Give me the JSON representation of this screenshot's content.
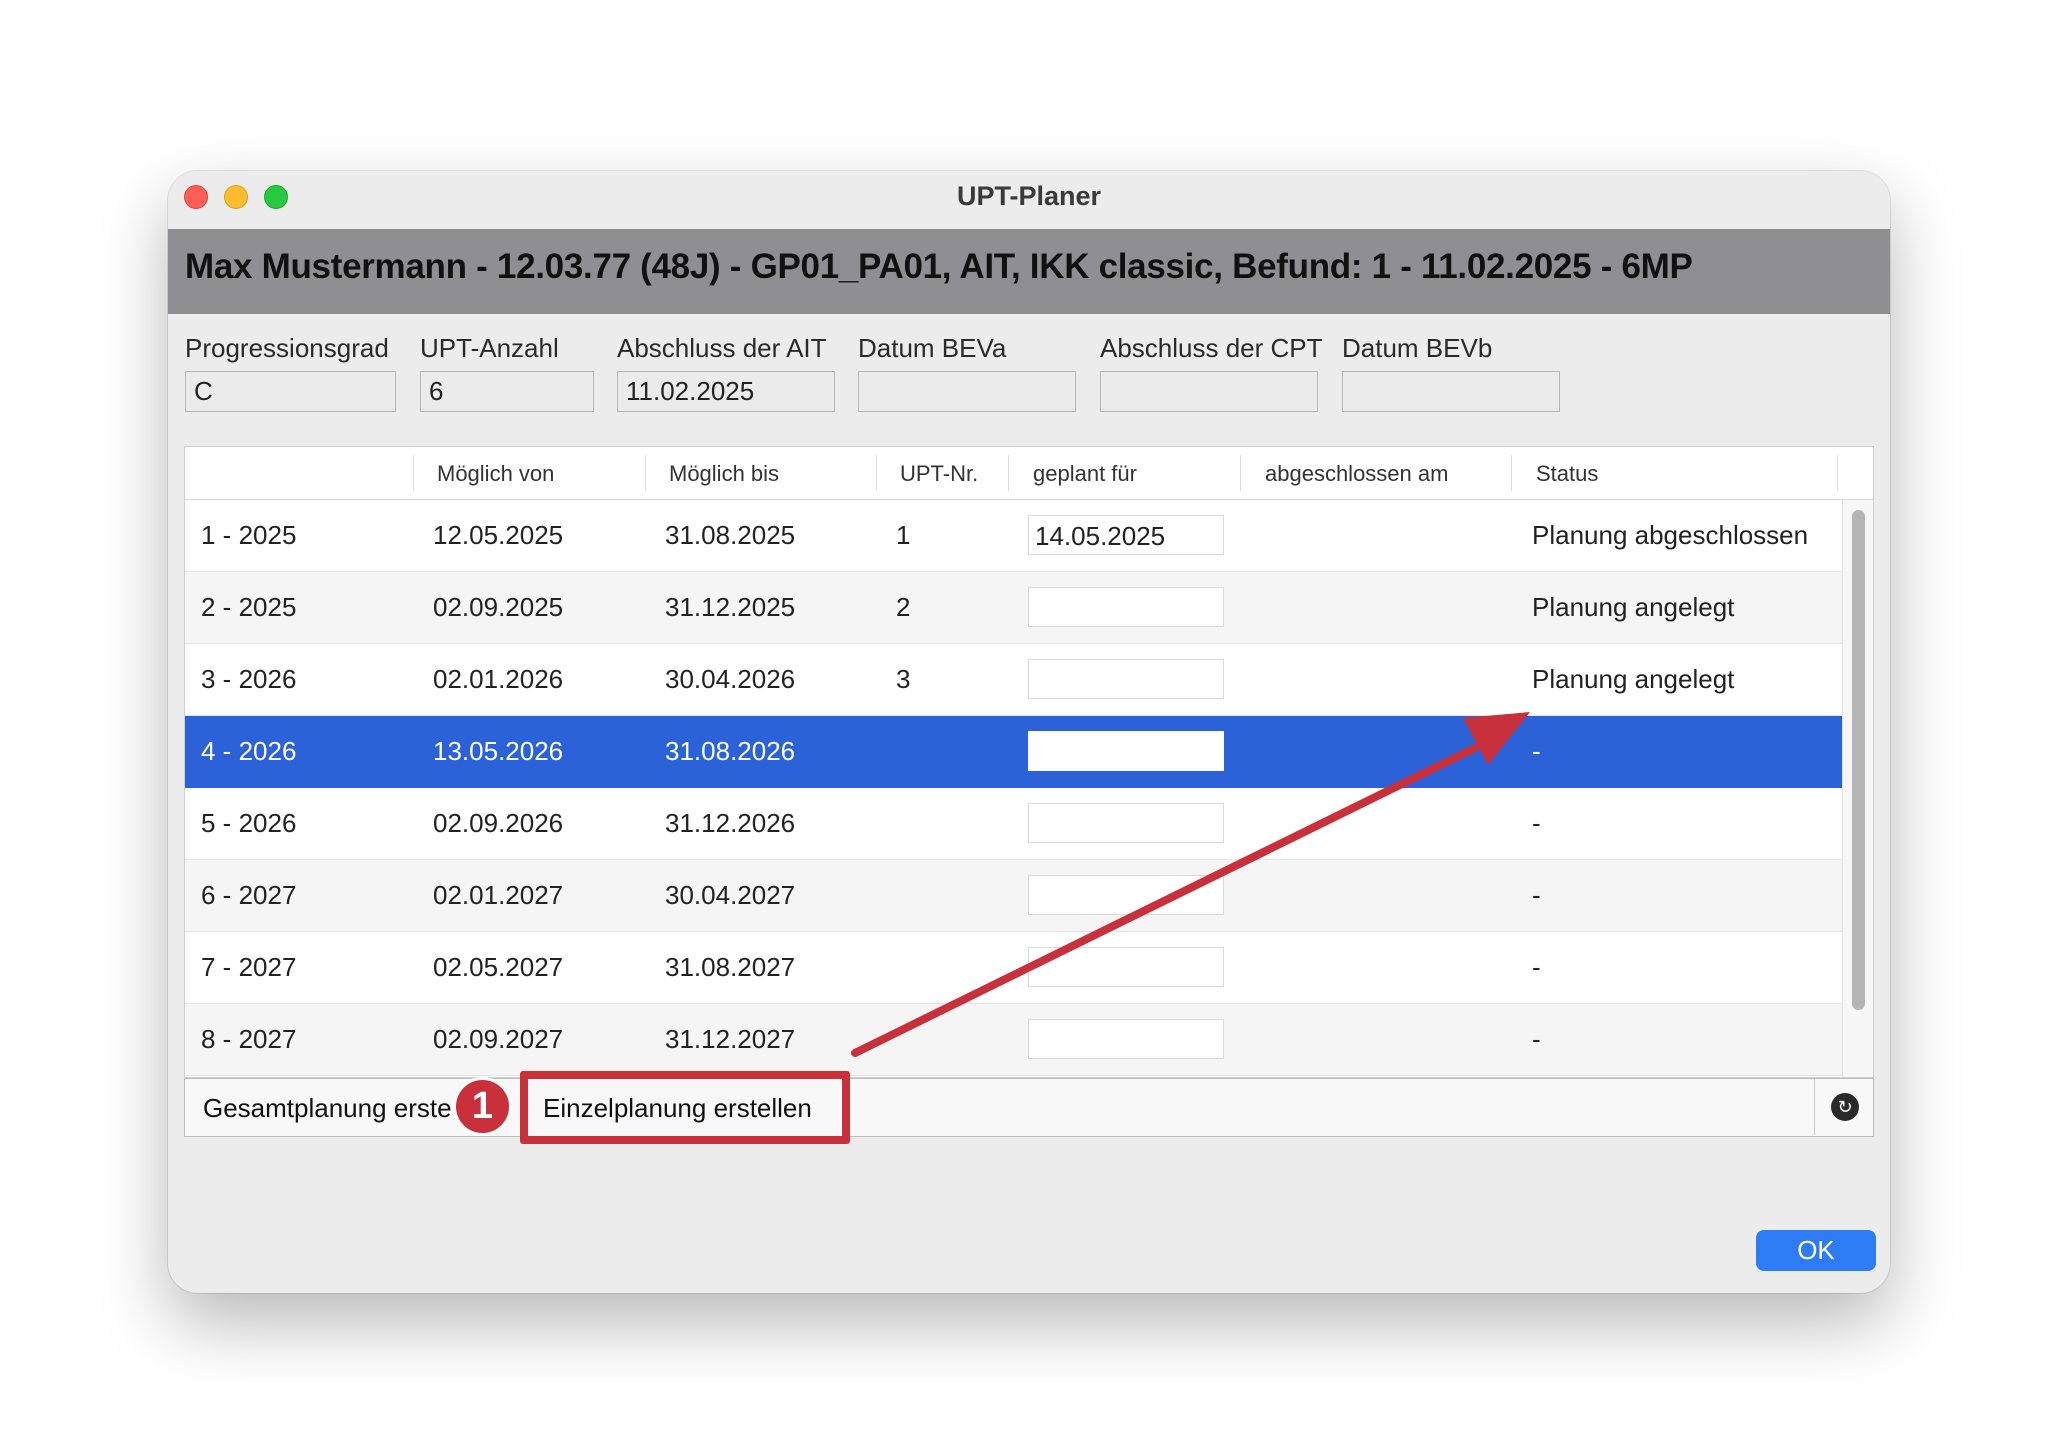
{
  "window": {
    "title": "UPT-Planer"
  },
  "header": {
    "text": "Max Mustermann - 12.03.77 (48J) - GP01_PA01, AIT, IKK classic, Befund: 1 - 11.02.2025 - 6MP"
  },
  "fields": [
    {
      "label": "Progressionsgrad",
      "value": "C"
    },
    {
      "label": "UPT-Anzahl",
      "value": "6"
    },
    {
      "label": "Abschluss der AIT",
      "value": "11.02.2025"
    },
    {
      "label": "Datum BEVa",
      "value": ""
    },
    {
      "label": "Abschluss der CPT",
      "value": ""
    },
    {
      "label": "Datum BEVb",
      "value": ""
    }
  ],
  "table": {
    "columns": [
      "",
      "Möglich von",
      "Möglich bis",
      "UPT-Nr.",
      "geplant für",
      "abgeschlossen am",
      "Status"
    ],
    "rows": [
      {
        "name": "1 - 2025",
        "from": "12.05.2025",
        "to": "31.08.2025",
        "upt": "1",
        "planned": "14.05.2025",
        "completed": "",
        "status": "Planung abgeschlossen"
      },
      {
        "name": "2 - 2025",
        "from": "02.09.2025",
        "to": "31.12.2025",
        "upt": "2",
        "planned": "",
        "completed": "",
        "status": "Planung angelegt"
      },
      {
        "name": "3 - 2026",
        "from": "02.01.2026",
        "to": "30.04.2026",
        "upt": "3",
        "planned": "",
        "completed": "",
        "status": "Planung angelegt"
      },
      {
        "name": "4 - 2026",
        "from": "13.05.2026",
        "to": "31.08.2026",
        "upt": "",
        "planned": "",
        "completed": "",
        "status": "-"
      },
      {
        "name": "5 - 2026",
        "from": "02.09.2026",
        "to": "31.12.2026",
        "upt": "",
        "planned": "",
        "completed": "",
        "status": "-"
      },
      {
        "name": "6 - 2027",
        "from": "02.01.2027",
        "to": "30.04.2027",
        "upt": "",
        "planned": "",
        "completed": "",
        "status": "-"
      },
      {
        "name": "7 - 2027",
        "from": "02.05.2027",
        "to": "31.08.2027",
        "upt": "",
        "planned": "",
        "completed": "",
        "status": "-"
      },
      {
        "name": "8 - 2027",
        "from": "02.09.2027",
        "to": "31.12.2027",
        "upt": "",
        "planned": "",
        "completed": "",
        "status": "-"
      }
    ],
    "selected_row": "4 - 2026"
  },
  "buttons": {
    "gesamtplanung": "Gesamtplanung erste",
    "einzelplanung": "Einzelplanung erstellen",
    "ok": "OK"
  },
  "annotation": {
    "badge": "1",
    "color": "#c8303b"
  },
  "icons": {
    "refresh": "refresh-icon"
  },
  "colors": {
    "selection": "#2c62d8",
    "ok_button": "#2d7cf6",
    "header_bar": "#8e8e93"
  }
}
